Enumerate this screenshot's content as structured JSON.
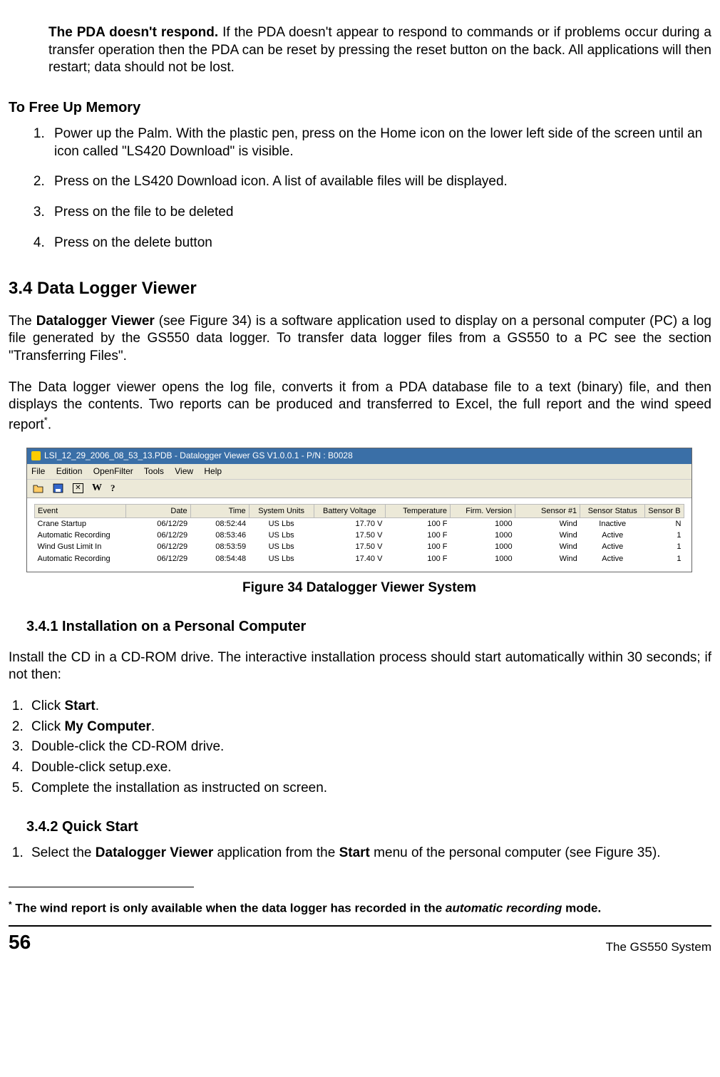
{
  "pda_para_bold": "The PDA doesn't respond.",
  "pda_para_rest": " If the PDA doesn't appear to respond to commands or if problems occur during a transfer operation then the PDA can be reset by pressing the reset button on the back. All applications will then restart; data should not be lost.",
  "tofree_heading": "To Free Up Memory",
  "tofree_items": [
    "Power up the Palm.  With the plastic pen, press on the Home icon on the lower left side of the screen until an icon called \"LS420 Download\" is visible.",
    "Press on the LS420 Download icon. A list of available files will be displayed.",
    "Press on the file to be deleted",
    "Press on the delete button"
  ],
  "sec34_heading": "3.4 Data Logger Viewer",
  "sec34_p1_a": "The ",
  "sec34_p1_b": "Datalogger Viewer",
  "sec34_p1_c": " (see Figure 34) is a software application used to display on a personal computer (PC) a log file generated by the GS550 data logger.  To transfer data logger files from a GS550 to a PC see the section \"Transferring Files\".",
  "sec34_p2": "The Data logger viewer opens the log file, converts it from a PDA database file to a text (binary) file, and then displays the contents. Two reports can be produced and transferred to Excel, the full report and the wind speed report",
  "sec34_p2_end": ".",
  "app": {
    "title": "LSI_12_29_2006_08_53_13.PDB - Datalogger Viewer GS V1.0.0.1 - P/N : B0028",
    "menu": [
      "File",
      "Edition",
      "OpenFilter",
      "Tools",
      "View",
      "Help"
    ],
    "toolbar_icons": [
      "open-icon",
      "save-icon",
      "close-icon",
      "w-icon",
      "help-icon"
    ],
    "columns": [
      "Event",
      "Date",
      "Time",
      "System Units",
      "Battery Voltage",
      "Temperature",
      "Firm. Version",
      "Sensor #1",
      "Sensor Status",
      "Sensor B"
    ],
    "rows": [
      [
        "Crane Startup",
        "06/12/29",
        "08:52:44",
        "US Lbs",
        "17.70 V",
        "100 F",
        "1000",
        "Wind",
        "Inactive",
        "N"
      ],
      [
        "Automatic Recording",
        "06/12/29",
        "08:53:46",
        "US Lbs",
        "17.50 V",
        "100 F",
        "1000",
        "Wind",
        "Active",
        "1"
      ],
      [
        "Wind Gust Limit In",
        "06/12/29",
        "08:53:59",
        "US Lbs",
        "17.50 V",
        "100 F",
        "1000",
        "Wind",
        "Active",
        "1"
      ],
      [
        "Automatic Recording",
        "06/12/29",
        "08:54:48",
        "US Lbs",
        "17.40 V",
        "100 F",
        "1000",
        "Wind",
        "Active",
        "1"
      ]
    ]
  },
  "fig_caption": "Figure 34  Datalogger Viewer System",
  "sec341_heading": "3.4.1 Installation on a Personal Computer",
  "sec341_p": "Install the CD in a CD-ROM drive. The interactive installation process should start automatically within 30 seconds; if not then:",
  "sec341_items_pre": [
    "Click ",
    "Click ",
    "Double-click the CD-ROM drive.",
    "Double-click setup.exe.",
    "Complete the installation as instructed on screen."
  ],
  "sec341_bold1": "Start",
  "sec341_bold2": "My Computer",
  "sec342_heading": "3.4.2 Quick Start",
  "sec342_item_a": "Select the ",
  "sec342_item_b": "Datalogger Viewer",
  "sec342_item_c": " application from the ",
  "sec342_item_d": "Start",
  "sec342_item_e": " menu of the personal computer (see Figure 35).",
  "footnote_star": "*",
  "footnote_a": " The wind report is only available when the data logger has recorded in the ",
  "footnote_b": "automatic recording",
  "footnote_c": " mode.",
  "page_num": "56",
  "sys_name": "The GS550 System"
}
